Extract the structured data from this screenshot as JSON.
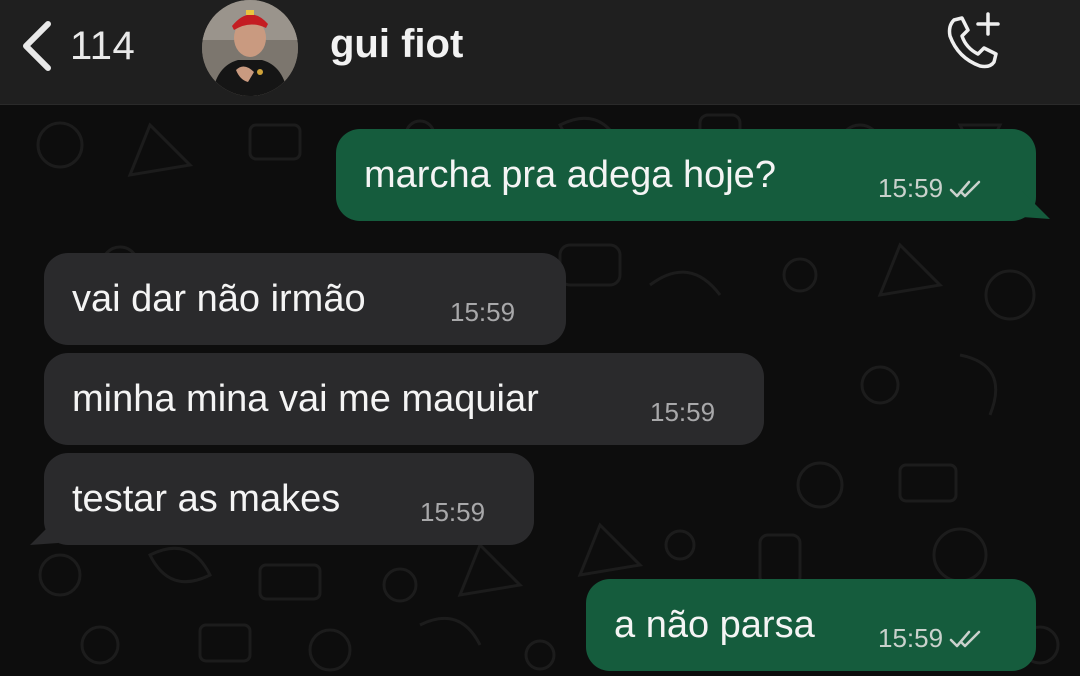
{
  "header": {
    "back_count": "114",
    "contact_name": "gui fiot"
  },
  "messages": [
    {
      "direction": "out",
      "text": "marcha pra adega hoje?",
      "time": "15:59",
      "status": "read"
    },
    {
      "direction": "in",
      "text": "vai dar não irmão",
      "time": "15:59"
    },
    {
      "direction": "in",
      "text": "minha mina vai me maquiar",
      "time": "15:59"
    },
    {
      "direction": "in",
      "text": "testar as makes",
      "time": "15:59"
    },
    {
      "direction": "out",
      "text": "a não parsa",
      "time": "15:59",
      "status": "read"
    }
  ],
  "colors": {
    "header_bg": "#1f1f1f",
    "outgoing_bubble": "#155c3d",
    "incoming_bubble": "#2a2a2c",
    "chat_bg": "#0d0d0d"
  },
  "icons": [
    "chevron-left-icon",
    "add-call-icon",
    "double-check-icon"
  ]
}
